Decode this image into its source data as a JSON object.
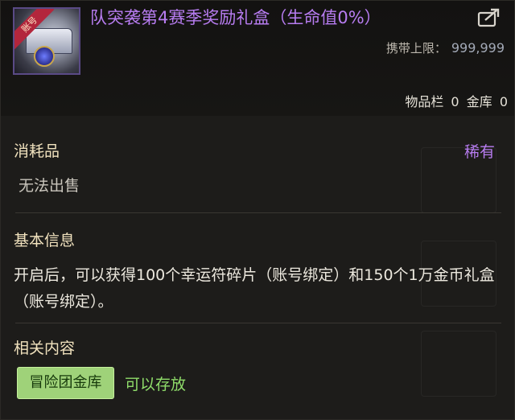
{
  "item": {
    "title": "队突袭第4赛季奖励礼盒（生命值0%）",
    "icon_ribbon": "账号",
    "icon": "treasure-chest-icon"
  },
  "header": {
    "limit_label": "携带上限：",
    "limit_value": "999,999",
    "inventory_label": "物品栏",
    "inventory_value": "0",
    "vault_label": "金库",
    "vault_value": "0"
  },
  "type_section": {
    "category": "消耗品",
    "rarity": "稀有",
    "sell_status": "无法出售"
  },
  "info_section": {
    "heading": "基本信息",
    "description": "开启后，可以获得100个幸运符碎片（账号绑定）和150个1万金币礼盒（账号绑定）。"
  },
  "related_section": {
    "heading": "相关内容",
    "badge": "冒险团金库",
    "status": "可以存放"
  },
  "colors": {
    "title": "#b77cf0",
    "heading": "#f1e2be",
    "badge_bg": "#9fd279",
    "status_text": "#8fdc6a"
  }
}
